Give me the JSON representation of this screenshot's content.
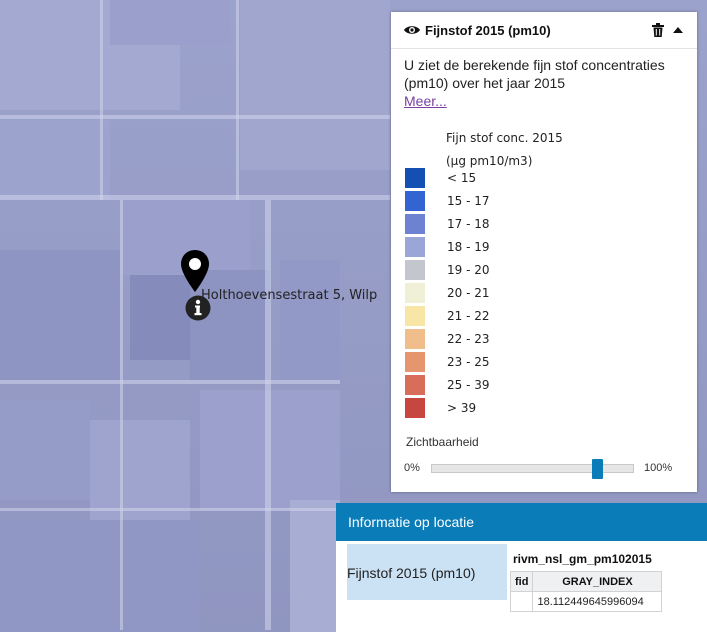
{
  "map": {
    "marker_icon": "map-pin-icon",
    "info_icon": "info-icon",
    "marker_label": "Holthoevensestraat 5, Wilp"
  },
  "legend": {
    "title": "Fijnstof 2015 (pm10)",
    "description": "U ziet de berekende fijn stof concentraties (pm10) over het jaar 2015",
    "more_link": "Meer...",
    "scale_title_line1": "Fijn stof conc. 2015",
    "scale_title_line2": "(µg pm10/m3)",
    "items": [
      {
        "label": "< 15",
        "color": "#1450b4"
      },
      {
        "label": "15 - 17",
        "color": "#3264d2"
      },
      {
        "label": "17 - 18",
        "color": "#6e82d2"
      },
      {
        "label": "18 - 19",
        "color": "#9aa6d6"
      },
      {
        "label": "19 - 20",
        "color": "#c3c6cc"
      },
      {
        "label": "20 - 21",
        "color": "#f0f0d6"
      },
      {
        "label": "21 - 22",
        "color": "#f8e6a6"
      },
      {
        "label": "22 - 23",
        "color": "#f0be8c"
      },
      {
        "label": "23 - 25",
        "color": "#e6966e"
      },
      {
        "label": "25 - 39",
        "color": "#d66e5a"
      },
      {
        "label": "> 39",
        "color": "#c84640"
      }
    ],
    "opacity": {
      "label": "Zichtbaarheid",
      "min_label": "0%",
      "max_label": "100%",
      "value_percent": 84,
      "accent": "#0a7cb8"
    },
    "icons": {
      "visibility": "eye-icon",
      "delete": "trash-icon",
      "collapse": "chevron-up-icon"
    }
  },
  "info_panel": {
    "title": "Informatie op locatie",
    "layer_name": "Fijnstof 2015 (pm10)",
    "feature_layer": "rivm_nsl_gm_pm102015",
    "table": {
      "headers": [
        "fid",
        "GRAY_INDEX"
      ],
      "rows": [
        [
          "",
          "18.112449645996094"
        ]
      ]
    }
  }
}
